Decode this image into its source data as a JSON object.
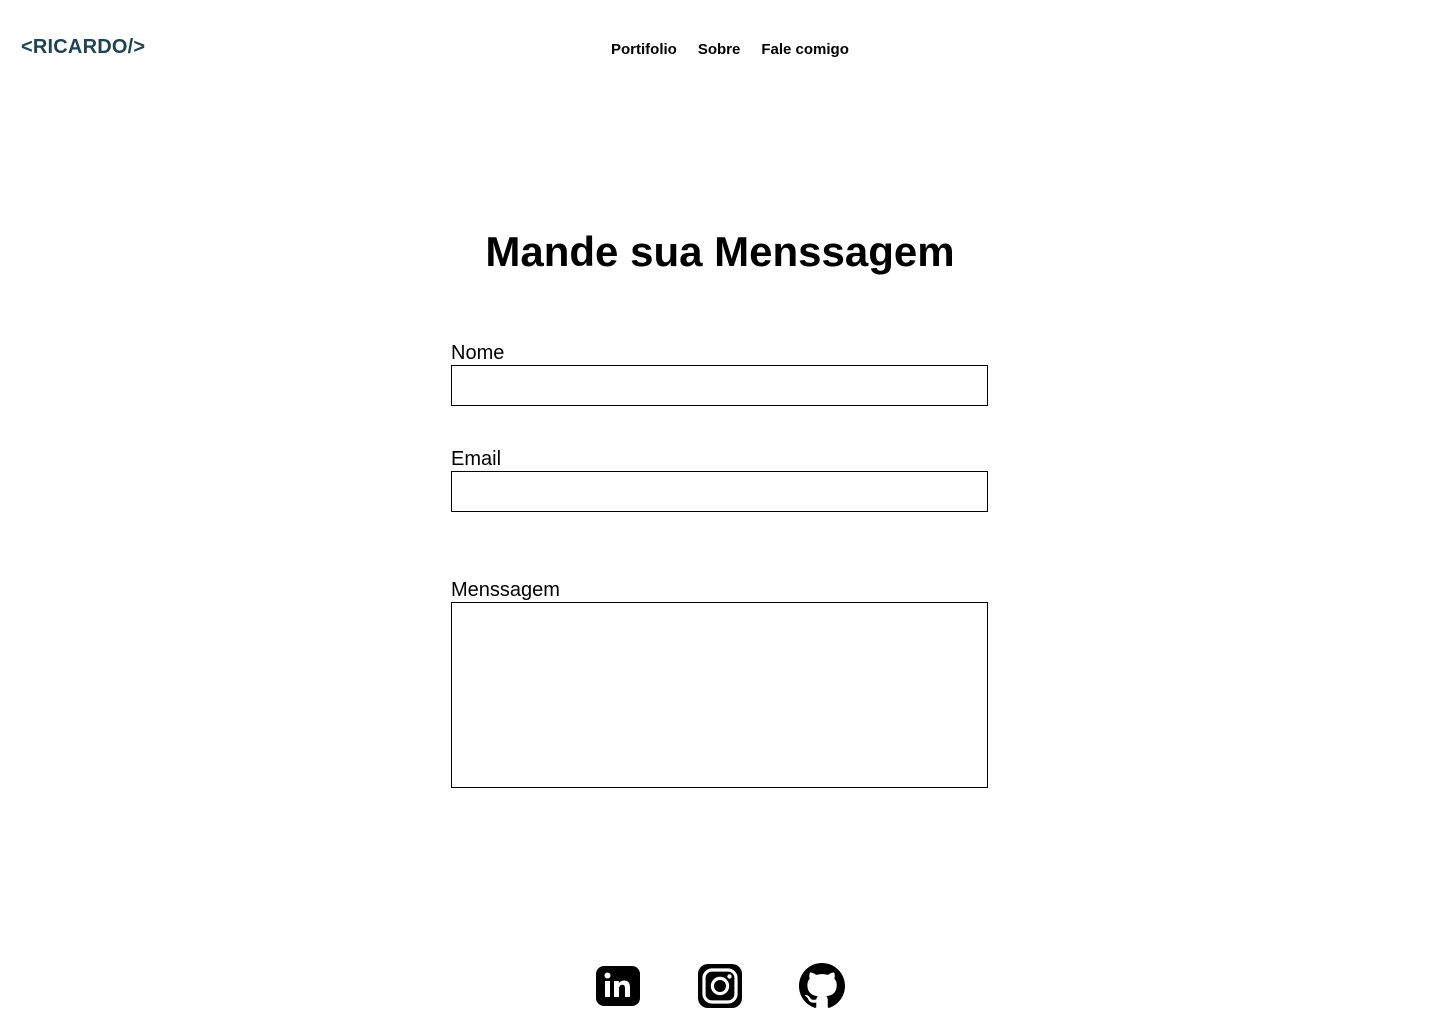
{
  "header": {
    "logo_text": "<RICARDO/>",
    "logo_color": "#1f4354",
    "nav": [
      {
        "label": "Portifolio"
      },
      {
        "label": "Sobre"
      },
      {
        "label": "Fale comigo"
      }
    ]
  },
  "main": {
    "title": "Mande sua Menssagem",
    "form": {
      "name_label": "Nome",
      "name_value": "",
      "email_label": "Email",
      "email_value": "",
      "message_label": "Menssagem",
      "message_value": ""
    }
  },
  "footer": {
    "socials": [
      {
        "icon": "linkedin-icon"
      },
      {
        "icon": "instagram-icon"
      },
      {
        "icon": "github-icon"
      }
    ]
  }
}
